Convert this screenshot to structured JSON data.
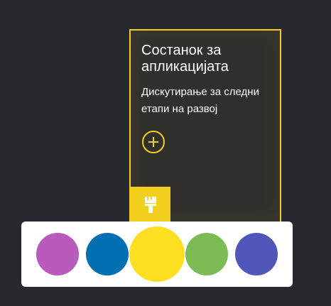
{
  "note": {
    "title": "Состанок за апликацијата",
    "body": "Дискутирање за следни етапи на развој",
    "border_color": "#f2cf1c",
    "add_icon": "plus-icon",
    "paint_icon": "paintbrush-icon"
  },
  "palette": {
    "colors": [
      {
        "name": "purple",
        "hex": "#b85bbd",
        "selected": false
      },
      {
        "name": "blue",
        "hex": "#0070b3",
        "selected": false
      },
      {
        "name": "yellow",
        "hex": "#fede21",
        "selected": true
      },
      {
        "name": "green",
        "hex": "#7dbc55",
        "selected": false
      },
      {
        "name": "indigo",
        "hex": "#5156bb",
        "selected": false
      }
    ]
  }
}
